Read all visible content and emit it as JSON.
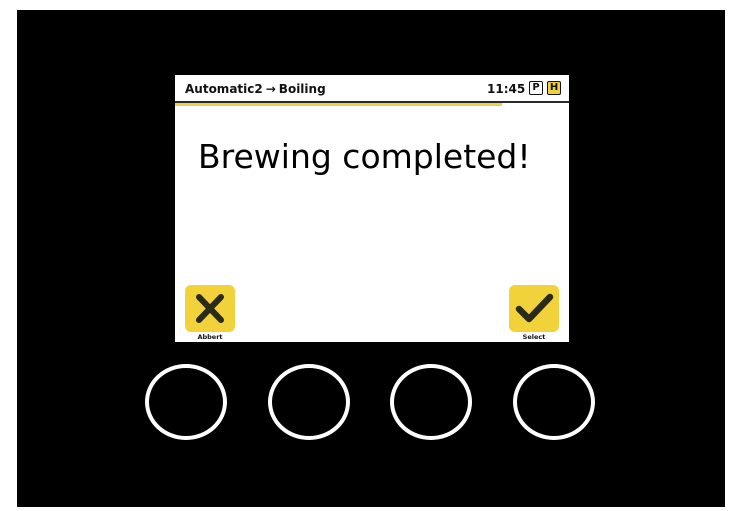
{
  "header": {
    "program": "Automatic2",
    "arrow": "→",
    "step": "Boiling",
    "time": "11:45",
    "badge_p": "P",
    "badge_h": "H"
  },
  "progress": {
    "fraction": 0.83,
    "color": "#e8d44a"
  },
  "main": {
    "message": "Brewing completed!"
  },
  "softkeys": {
    "left": {
      "label": "Abbert",
      "icon": "close-icon"
    },
    "right": {
      "label": "Select",
      "icon": "checkmark-icon"
    }
  },
  "colors": {
    "accent": "#f2d23a",
    "device": "#000000"
  },
  "hardware_buttons": [
    "button-1",
    "button-2",
    "button-3",
    "button-4"
  ]
}
